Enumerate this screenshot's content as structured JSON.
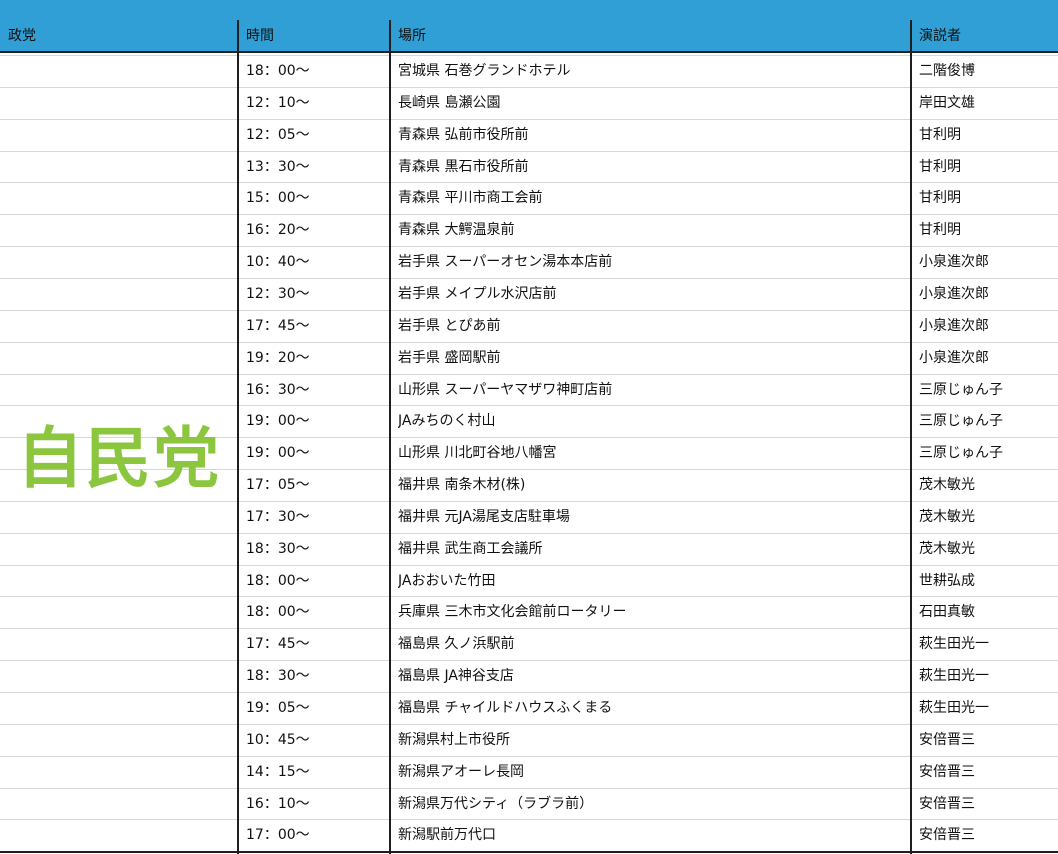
{
  "header": {
    "party": "政党",
    "time": "時間",
    "place": "場所",
    "speaker": "演説者"
  },
  "party_name": "自民党",
  "colors": {
    "header_bg": "#2f9fd5",
    "party_text": "#8cc63f",
    "grid": "#d6d6d6",
    "border": "#1f1f1f"
  },
  "rows": [
    {
      "time": "18：00〜",
      "place": "宮城県 石巻グランドホテル",
      "speaker": "二階俊博"
    },
    {
      "time": "12：10〜",
      "place": "長崎県 島瀬公園",
      "speaker": "岸田文雄"
    },
    {
      "time": "12：05〜",
      "place": "青森県 弘前市役所前",
      "speaker": "甘利明"
    },
    {
      "time": "13：30〜",
      "place": "青森県 黒石市役所前",
      "speaker": "甘利明"
    },
    {
      "time": "15：00〜",
      "place": "青森県 平川市商工会前",
      "speaker": "甘利明"
    },
    {
      "time": "16：20〜",
      "place": "青森県 大鰐温泉前",
      "speaker": "甘利明"
    },
    {
      "time": "10：40〜",
      "place": "岩手県 スーパーオセン湯本本店前",
      "speaker": "小泉進次郎"
    },
    {
      "time": "12：30〜",
      "place": "岩手県 メイプル水沢店前",
      "speaker": "小泉進次郎"
    },
    {
      "time": "17：45〜",
      "place": "岩手県 とぴあ前",
      "speaker": "小泉進次郎"
    },
    {
      "time": "19：20〜",
      "place": "岩手県 盛岡駅前",
      "speaker": "小泉進次郎"
    },
    {
      "time": "16：30〜",
      "place": "山形県 スーパーヤマザワ神町店前",
      "speaker": "三原じゅん子"
    },
    {
      "time": "19：00〜",
      "place": "JAみちのく村山",
      "speaker": "三原じゅん子"
    },
    {
      "time": "19：00〜",
      "place": "山形県 川北町谷地八幡宮",
      "speaker": "三原じゅん子"
    },
    {
      "time": "17：05〜",
      "place": "福井県 南条木材(株)",
      "speaker": "茂木敏光"
    },
    {
      "time": "17：30〜",
      "place": "福井県 元JA湯尾支店駐車場",
      "speaker": "茂木敏光"
    },
    {
      "time": "18：30〜",
      "place": "福井県 武生商工会議所",
      "speaker": "茂木敏光"
    },
    {
      "time": "18：00〜",
      "place": "JAおおいた竹田",
      "speaker": "世耕弘成"
    },
    {
      "time": "18：00〜",
      "place": "兵庫県 三木市文化会館前ロータリー",
      "speaker": "石田真敏"
    },
    {
      "time": "17：45〜",
      "place": "福島県 久ノ浜駅前",
      "speaker": "萩生田光一"
    },
    {
      "time": "18：30〜",
      "place": "福島県 JA神谷支店",
      "speaker": "萩生田光一"
    },
    {
      "time": "19：05〜",
      "place": "福島県 チャイルドハウスふくまる",
      "speaker": "萩生田光一"
    },
    {
      "time": "10：45〜",
      "place": "新潟県村上市役所",
      "speaker": "安倍晋三"
    },
    {
      "time": "14：15〜",
      "place": "新潟県アオーレ長岡",
      "speaker": "安倍晋三"
    },
    {
      "time": "16：10〜",
      "place": "新潟県万代シティ（ラブラ前）",
      "speaker": "安倍晋三"
    },
    {
      "time": "17：00〜",
      "place": "新潟駅前万代口",
      "speaker": "安倍晋三"
    }
  ]
}
